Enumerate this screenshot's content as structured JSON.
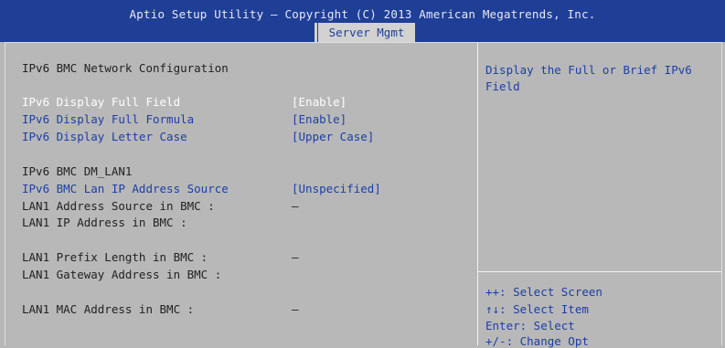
{
  "header": {
    "title": "Aptio Setup Utility – Copyright (C) 2013 American Megatrends, Inc.",
    "active_tab": "Server Mgmt"
  },
  "main": {
    "heading": "IPv6 BMC Network Configuration",
    "items": [
      {
        "label": "IPv6 Display Full Field",
        "value": "[Enable]"
      },
      {
        "label": "IPv6 Display Full Formula",
        "value": "[Enable]"
      },
      {
        "label": "IPv6 Display Letter Case",
        "value": "[Upper Case]"
      }
    ],
    "lan_heading": "IPv6 BMC DM_LAN1",
    "lan_items": [
      {
        "label": "IPv6 BMC Lan IP Address Source",
        "value": "[Unspecified]"
      },
      {
        "label": "LAN1 Address Source in BMC :",
        "value": "–"
      },
      {
        "label": "LAN1 IP Address in BMC :",
        "value": ""
      },
      {
        "label": "LAN1 Prefix Length in BMC :",
        "value": "–"
      },
      {
        "label": "LAN1 Gateway Address in BMC :",
        "value": ""
      },
      {
        "label": "LAN1 MAC Address in BMC :",
        "value": "–"
      }
    ]
  },
  "help": {
    "text": "Display the Full or Brief IPv6 Field"
  },
  "hints": [
    "++: Select Screen",
    "↑↓: Select Item",
    "Enter: Select",
    "+/-: Change Opt"
  ]
}
